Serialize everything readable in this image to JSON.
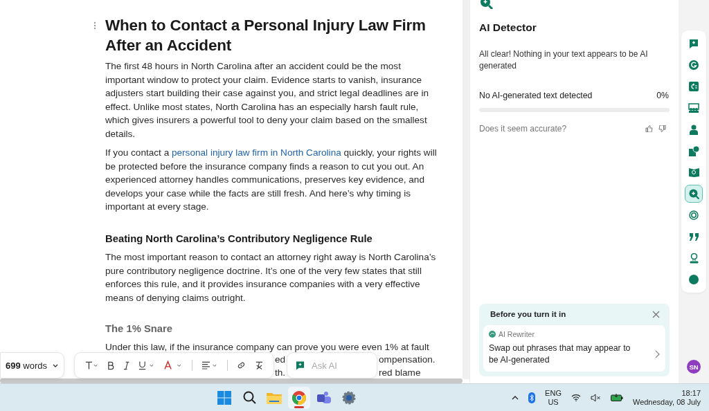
{
  "document": {
    "title": "When to Contact a Personal Injury Law Firm After an Accident",
    "blocks": [
      {
        "kind": "paragraph",
        "segments": [
          {
            "text": "The first 48 hours in North Carolina after an accident could be the most important window to protect your claim. Evidence starts to vanish, insurance adjusters start building their case against you, and strict legal deadlines are in effect. Unlike most states, North Carolina has an especially harsh fault rule, which gives insurers a powerful tool to deny your claim based on the smallest details.",
            "link": false
          }
        ]
      },
      {
        "kind": "paragraph",
        "segments": [
          {
            "text": "If you contact a ",
            "link": false
          },
          {
            "text": "personal injury law firm in North Carolina",
            "link": true
          },
          {
            "text": " quickly, your rights will be protected before the insurance company finds a reason to cut you out. An experienced attorney handles communications, preserves key evidence, and develops your case while the facts are still fresh. And here’s why timing is important at every stage.",
            "link": false
          }
        ]
      },
      {
        "kind": "heading",
        "segments": [
          {
            "text": "Beating North Carolina’s Contributory Negligence Rule",
            "link": false
          }
        ]
      },
      {
        "kind": "paragraph",
        "segments": [
          {
            "text": "The most important reason to contact an attorney right away is North Carolina’s pure contributory negligence doctrine. It’s one of the very few states that still enforces this rule, and it provides insurance companies with a very effective means of denying claims outright.",
            "link": false
          }
        ]
      },
      {
        "kind": "subheading",
        "segments": [
          {
            "text": "The 1% Snare",
            "link": false
          }
        ]
      },
      {
        "kind": "paragraph",
        "segments": [
          {
            "text": "Under this law, if the insurance company can prove you were even 1% at fault",
            "link": false
          }
        ]
      }
    ],
    "hidden_lines": [
      [
        "ed",
        "ompensation."
      ],
      [
        "th.",
        "red blame"
      ]
    ]
  },
  "toolbar": {
    "word_count": "**699** words",
    "ask_ai_placeholder": "Ask AI"
  },
  "panel": {
    "title": "AI Detector",
    "message": "All clear! Nothing in your text appears to be AI generated",
    "result_label": "No AI-generated text detected",
    "result_value": "0%",
    "level": 0,
    "feedback": "Does it seem accurate?",
    "card": {
      "title": "Before you turn it in",
      "tool": "AI Rewriter",
      "text": "Swap out phrases that may appear to be AI-generated"
    }
  },
  "rail": {
    "items": [
      {
        "kind": "chat",
        "selected": false
      },
      {
        "kind": "g",
        "selected": false
      },
      {
        "kind": "refresh",
        "selected": false
      },
      {
        "kind": "people",
        "selected": false
      },
      {
        "kind": "person",
        "selected": false
      },
      {
        "kind": "card",
        "selected": false
      },
      {
        "kind": "book",
        "selected": false
      },
      {
        "kind": "search",
        "selected": true
      },
      {
        "kind": "target",
        "selected": false
      },
      {
        "kind": "quote",
        "selected": false
      },
      {
        "kind": "stamp",
        "selected": false
      },
      {
        "kind": "dot",
        "selected": false
      }
    ],
    "avatar": "SN"
  },
  "taskbar": {
    "apps": [
      {
        "kind": "windows",
        "active": false
      },
      {
        "kind": "search",
        "active": false
      },
      {
        "kind": "folder",
        "active": false
      },
      {
        "kind": "chrome",
        "active": true
      },
      {
        "kind": "teams",
        "active": false
      },
      {
        "kind": "settings",
        "active": false
      }
    ],
    "lang": "ENG",
    "region": "US",
    "time": "18:17",
    "date": "Wednesday, 08 July"
  }
}
